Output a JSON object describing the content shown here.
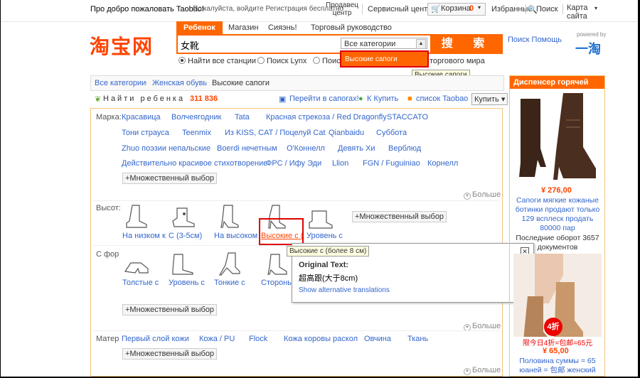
{
  "topbar": {
    "welcome": "Про добро пожаловать Taobao!",
    "login_register": "Пожалуйста, войдите Регистрация бесплатно",
    "seller_center": "Продавец центр",
    "service_center": "Сервисный центр",
    "cart_label": "Корзина",
    "cart_count": "0",
    "favorites": "Избранные",
    "search": "Поиск",
    "site_map": "Карта сайта"
  },
  "logo": "淘宝网",
  "search": {
    "tabs": [
      "Ребенок",
      "Магазин",
      "Сияэнь!",
      "Торговый руководство"
    ],
    "query": "女靴",
    "category": "Все категории",
    "button": "搜 索",
    "help": "Поиск Помощь",
    "powered_by": "powered by",
    "powered_logo": "一淘",
    "dropdown_option": "Высокие сапоги",
    "radios": [
      "Найти все станции",
      "Поиск Lynx",
      "Поиск",
      "торгового мира"
    ],
    "tooltip": "Высокие сапоги"
  },
  "breadcrumb": [
    "Все категории",
    "Женская обувь",
    "Высокие сапоги"
  ],
  "found": {
    "label": "Найти ребенка",
    "count": "311 836",
    "links": [
      "Перейти в сапогах!",
      "К Купить",
      "список Taobao"
    ],
    "buy_select": "Купить"
  },
  "filters": {
    "brand_label": "Марка:",
    "brands": [
      [
        "Красавица",
        "Волчеягодник",
        "Tata",
        "Красная стрекоза / Red Dragonfly",
        "STACCATO"
      ],
      [
        "Тони страуса",
        "Teenmix",
        "Из KISS, CAT / Поцелуй Cat",
        "Qianbaidu",
        "Суббота"
      ],
      [
        "Zhuo поэзии непальские",
        "Boerdi нечетным",
        "О'Коннелл",
        "Девять Хи",
        "Верблюд"
      ],
      [
        "Действительно красивое стихотворение",
        "ФРС / Ифу Эди",
        "Llion",
        "FGN / Fuguiniao",
        "Корнелл"
      ]
    ],
    "multi_select": "+Множественный выбор",
    "more": "Больше",
    "height_label": "Высот:",
    "heights": [
      "На низком к",
      "С (3-5см)",
      "На высоком",
      "Высокие с (",
      "Уровень с"
    ],
    "form_label": "С фор",
    "forms": [
      "Толстые с",
      "Уровень с",
      "Тонкие с",
      "Стороны с"
    ],
    "material_label": "Матер",
    "materials": [
      "Первый слой кожи",
      "Кожа / PU",
      "Flock",
      "Кожа коровы раскол",
      "Овчина",
      "Ткань"
    ]
  },
  "translation": {
    "tooltip": "Высокие с (более 8 см)",
    "title": "Original Text:",
    "original": "超高跟(大于8cm)",
    "alt": "Show alternative translations"
  },
  "sidebar": {
    "header": "Диспенсер горячей",
    "item1_price": "¥ 276,00",
    "item1_desc": "Сапоги мягкие кожаные ботинки продают только 129 всплеск продать 80000 пар",
    "item1_sales": "Последние оборот 3657 документов",
    "item2_badge": "4折",
    "item2_promo": "限今日4折=包邮=65元",
    "item2_price": "¥ 65,00",
    "item2_desc": "Половина суммы = 65 юаней = 包邮 женский"
  }
}
